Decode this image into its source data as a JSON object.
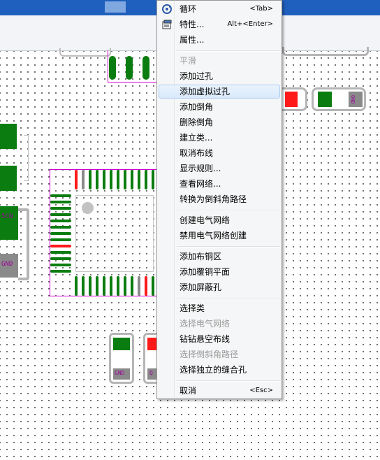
{
  "menu": {
    "items": [
      {
        "label": "循环",
        "shortcut": "<Tab>",
        "icon": "cycle-icon",
        "disabled": false
      },
      {
        "label": "特性...",
        "shortcut": "Alt+<Enter>",
        "icon": "properties-icon",
        "disabled": false
      },
      {
        "label": "属性...",
        "shortcut": "",
        "disabled": false
      },
      {
        "label": "平滑",
        "shortcut": "",
        "disabled": true
      },
      {
        "label": "添加过孔",
        "shortcut": "",
        "disabled": false
      },
      {
        "label": "添加虚拟过孔",
        "shortcut": "",
        "disabled": false,
        "highlighted": true
      },
      {
        "label": "添加倒角",
        "shortcut": "",
        "disabled": false
      },
      {
        "label": "删除倒角",
        "shortcut": "",
        "disabled": false
      },
      {
        "label": "建立类...",
        "shortcut": "",
        "disabled": false
      },
      {
        "label": "取消布线",
        "shortcut": "",
        "disabled": false
      },
      {
        "label": "显示规则...",
        "shortcut": "",
        "disabled": false
      },
      {
        "label": "查看网络...",
        "shortcut": "",
        "disabled": false
      },
      {
        "label": "转换为倒斜角路径",
        "shortcut": "",
        "disabled": false
      },
      {
        "label": "创建电气网络",
        "shortcut": "",
        "disabled": false
      },
      {
        "label": "禁用电气网络创建",
        "shortcut": "",
        "disabled": false
      },
      {
        "label": "添加布铜区",
        "shortcut": "",
        "disabled": false
      },
      {
        "label": "添加覆铜平面",
        "shortcut": "",
        "disabled": false
      },
      {
        "label": "添加屏蔽孔",
        "shortcut": "",
        "disabled": false
      },
      {
        "label": "选择类",
        "shortcut": "",
        "disabled": false
      },
      {
        "label": "选择电气网络",
        "shortcut": "",
        "disabled": true
      },
      {
        "label": "钻钻悬空布线",
        "shortcut": "",
        "disabled": false
      },
      {
        "label": "选择倒斜角路径",
        "shortcut": "",
        "disabled": true
      },
      {
        "label": "选择独立的缝合孔",
        "shortcut": "",
        "disabled": false
      },
      {
        "label": "取消",
        "shortcut": "<Esc>",
        "disabled": false
      }
    ]
  },
  "board": {
    "labels": {
      "gnd_left": "GND",
      "con_left": "5CN",
      "gnd_right": "GND",
      "gnd_bottom": "GND",
      "q_bottom": "Q"
    }
  },
  "colors": {
    "pad_green": "#0b7d10",
    "pad_red": "#ff1a1a",
    "silkscreen": "#d000d0",
    "menu_highlight": "#d9e9fb"
  }
}
